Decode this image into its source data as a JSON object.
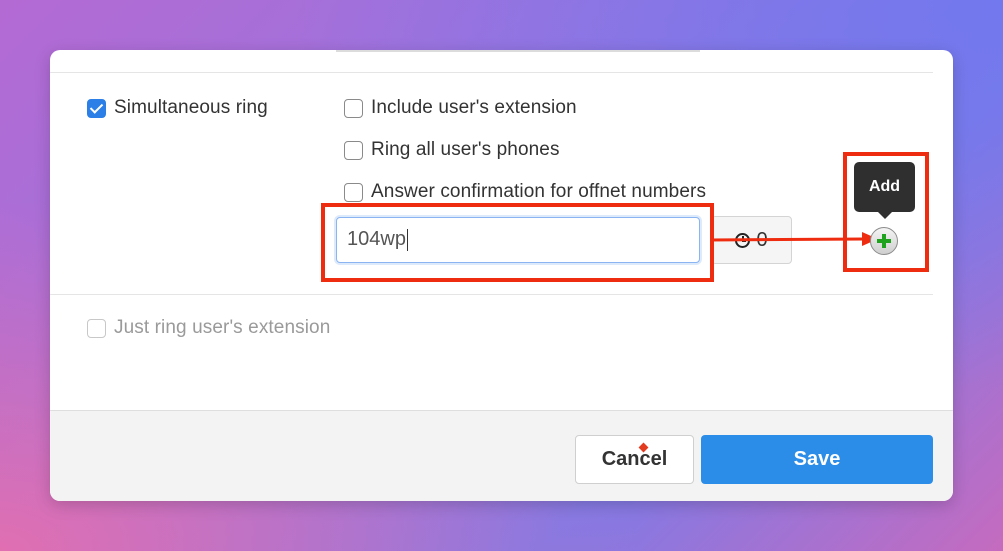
{
  "colors": {
    "accent": "#2b8de8",
    "highlight": "#ee2d10",
    "add_icon": "#1fa31f"
  },
  "ring": {
    "simultaneous_ring": {
      "label": "Simultaneous ring",
      "checked": true
    },
    "include_extension": {
      "label": "Include user's extension",
      "checked": false
    },
    "ring_all_phones": {
      "label": "Ring all user's phones",
      "checked": false
    },
    "answer_confirmation": {
      "label": "Answer confirmation for offnet numbers",
      "checked": false
    },
    "just_ring_extension": {
      "label": "Just ring user's extension",
      "checked": false,
      "disabled": true
    }
  },
  "number_entry": {
    "value": "104wp",
    "timer_value": "0",
    "timer_icon": "clock-icon",
    "add_icon": "plus-circle-icon",
    "add_tooltip": "Add"
  },
  "footer": {
    "cancel_label": "Cancel",
    "save_label": "Save"
  }
}
